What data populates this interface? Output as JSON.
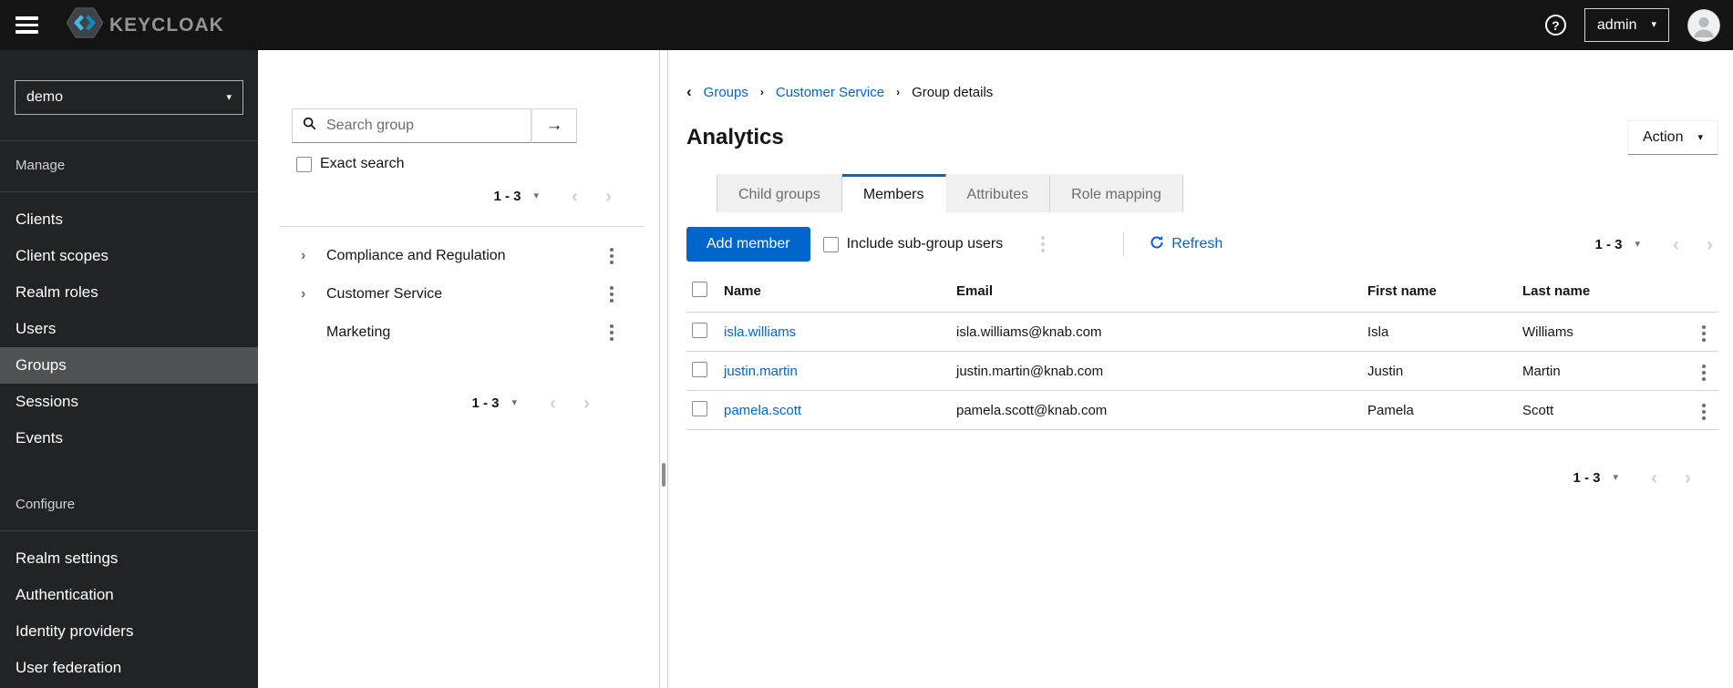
{
  "colors": {
    "accent": "#0066cc",
    "masthead_bg": "#141414",
    "sidebar_bg": "#212427",
    "sidebar_active_bg": "#4f5255",
    "tab_inactive_bg": "#f0f0f0"
  },
  "icons": {
    "caret_down": "▾",
    "chevron_left": "‹",
    "chevron_right": "›",
    "breadcrumb_separator": "›",
    "tree_expand": "›",
    "arrow_right": "→",
    "question_mark": "?"
  },
  "masthead": {
    "brand": "KEYCLOAK",
    "username": "admin"
  },
  "sidebar": {
    "realm": "demo",
    "sections": [
      {
        "label": "Manage",
        "items": [
          {
            "label": "Clients"
          },
          {
            "label": "Client scopes"
          },
          {
            "label": "Realm roles"
          },
          {
            "label": "Users"
          },
          {
            "label": "Groups",
            "active": true
          },
          {
            "label": "Sessions"
          },
          {
            "label": "Events"
          }
        ]
      },
      {
        "label": "Configure",
        "items": [
          {
            "label": "Realm settings"
          },
          {
            "label": "Authentication"
          },
          {
            "label": "Identity providers"
          },
          {
            "label": "User federation"
          }
        ]
      }
    ]
  },
  "groups_panel": {
    "search_placeholder": "Search group",
    "exact_search_label": "Exact search",
    "pagination_top": {
      "range": "1 - 3"
    },
    "pagination_bottom": {
      "range": "1 - 3"
    },
    "tree": [
      {
        "label": "Compliance and Regulation",
        "expandable": true
      },
      {
        "label": "Customer Service",
        "expandable": true
      },
      {
        "label": "Marketing",
        "expandable": false
      }
    ]
  },
  "main": {
    "breadcrumb": {
      "items": [
        {
          "label": "Groups",
          "link": true
        },
        {
          "label": "Customer Service",
          "link": true
        },
        {
          "label": "Group details",
          "link": false
        }
      ]
    },
    "title": "Analytics",
    "action_button": "Action",
    "tabs": [
      {
        "label": "Child groups"
      },
      {
        "label": "Members",
        "active": true
      },
      {
        "label": "Attributes"
      },
      {
        "label": "Role mapping"
      }
    ],
    "toolbar": {
      "add_member": "Add member",
      "include_subgroups": "Include sub-group users",
      "refresh": "Refresh",
      "pagination": {
        "range": "1 - 3"
      }
    },
    "table": {
      "columns": [
        "Name",
        "Email",
        "First name",
        "Last name"
      ],
      "rows": [
        {
          "name": "isla.williams",
          "email": "isla.williams@knab.com",
          "first_name": "Isla",
          "last_name": "Williams"
        },
        {
          "name": "justin.martin",
          "email": "justin.martin@knab.com",
          "first_name": "Justin",
          "last_name": "Martin"
        },
        {
          "name": "pamela.scott",
          "email": "pamela.scott@knab.com",
          "first_name": "Pamela",
          "last_name": "Scott"
        }
      ]
    },
    "pagination_bottom": {
      "range": "1 - 3"
    }
  }
}
